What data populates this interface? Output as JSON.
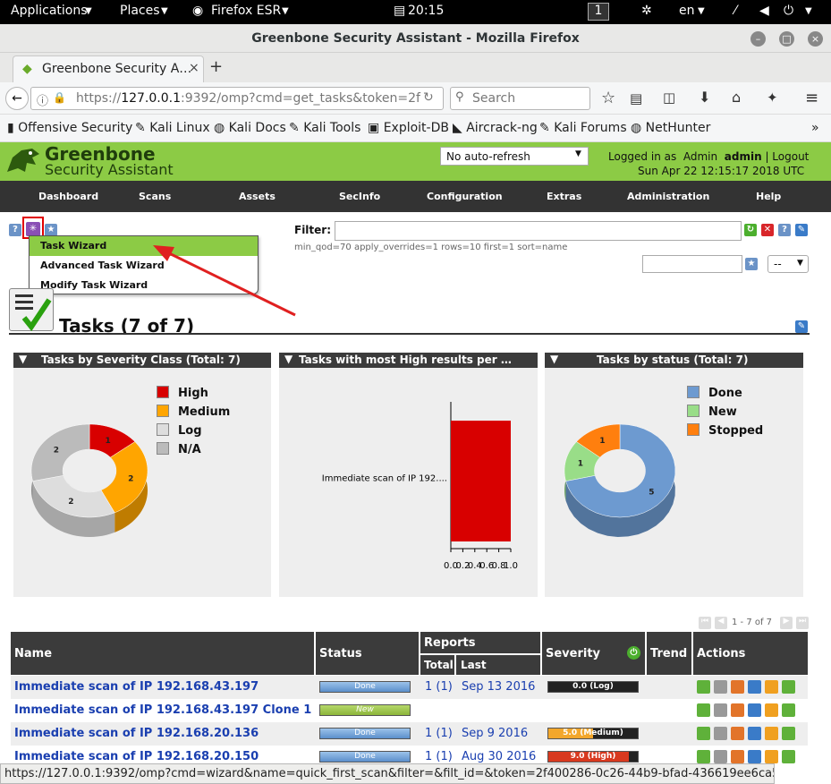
{
  "gnome": {
    "applications": "Applications",
    "places": "Places",
    "browser": "Firefox ESR",
    "time": "20:15",
    "workspace": "1",
    "lang": "en"
  },
  "window": {
    "title": "Greenbone Security Assistant - Mozilla Firefox"
  },
  "tab": {
    "label": "Greenbone Security A…",
    "new_tab": "+"
  },
  "nav": {
    "url_prefix": "https://",
    "url_host": "127.0.0.1",
    "url_rest": ":9392/omp?cmd=get_tasks&token=2f",
    "search_placeholder": "Search"
  },
  "bookmarks": [
    "Offensive Security",
    "Kali Linux",
    "Kali Docs",
    "Kali Tools",
    "Exploit-DB",
    "Aircrack-ng",
    "Kali Forums",
    "NetHunter"
  ],
  "gsa": {
    "logo_line1": "Greenbone",
    "logo_line2": "Security Assistant",
    "refresh": "No auto-refresh",
    "logged_in_prefix": "Logged in as",
    "role": "Admin",
    "user": "admin",
    "logout": "Logout",
    "datetime": "Sun Apr 22 12:15:17 2018 UTC",
    "menu": [
      "Dashboard",
      "Scans",
      "Assets",
      "SecInfo",
      "Configuration",
      "Extras",
      "Administration",
      "Help"
    ],
    "filter_label": "Filter:",
    "filter_params": "min_qod=70 apply_overrides=1 rows=10 first=1 sort=name",
    "filter_select": "--",
    "wizard_menu": [
      "Task Wizard",
      "Advanced Task Wizard",
      "Modify Task Wizard"
    ],
    "page_title": "Tasks (7 of 7)",
    "pagination": "1 - 7 of 7"
  },
  "panels": {
    "severity": {
      "title": "Tasks by Severity Class (Total: 7)"
    },
    "high": {
      "title": "Tasks with most High results per …"
    },
    "status": {
      "title": "Tasks by status (Total: 7)"
    }
  },
  "chart_data": [
    {
      "type": "pie",
      "title": "Tasks by Severity Class (Total: 7)",
      "categories": [
        "High",
        "Medium",
        "Log",
        "N/A"
      ],
      "values": [
        1,
        2,
        2,
        2
      ],
      "colors": [
        "#d80000",
        "#ffa500",
        "#dddddd",
        "#bbbbbb"
      ],
      "legend": "top-right"
    },
    {
      "type": "bar",
      "title": "Tasks with most High results per …",
      "categories": [
        "Immediate scan of IP 192...."
      ],
      "values": [
        1.0
      ],
      "ticks": [
        "0.0",
        "0.2",
        "0.4",
        "0.6",
        "0.8",
        "1.0"
      ],
      "ylim": [
        0,
        1
      ],
      "colors": [
        "#d80000"
      ]
    },
    {
      "type": "pie",
      "title": "Tasks by status (Total: 7)",
      "categories": [
        "Done",
        "New",
        "Stopped"
      ],
      "values": [
        5,
        1,
        1
      ],
      "colors": [
        "#6d9ad0",
        "#99dd88",
        "#ff7f0e"
      ],
      "legend": "top-right"
    }
  ],
  "table": {
    "headers": {
      "name": "Name",
      "status": "Status",
      "reports": "Reports",
      "total": "Total",
      "last": "Last",
      "severity": "Severity",
      "trend": "Trend",
      "actions": "Actions"
    },
    "rows": [
      {
        "name": "Immediate scan of IP 192.168.43.197",
        "status": "Done",
        "total": "1 (1)",
        "last": "Sep 13 2016",
        "severity": "0.0 (Log)",
        "sev_fill": 0
      },
      {
        "name": "Immediate scan of IP 192.168.43.197 Clone 1",
        "status": "New",
        "total": "",
        "last": "",
        "severity": "",
        "sev_fill": null
      },
      {
        "name": "Immediate scan of IP 192.168.20.136",
        "status": "Done",
        "total": "1 (1)",
        "last": "Sep 9 2016",
        "severity": "5.0 (Medium)",
        "sev_fill": 0.5
      },
      {
        "name": "Immediate scan of IP 192.168.20.150",
        "status": "Done",
        "total": "1 (1)",
        "last": "Aug 30 2016",
        "severity": "9.0 (High)",
        "sev_fill": 0.9
      }
    ]
  },
  "statusbar": "https://127.0.0.1:9392/omp?cmd=wizard&name=quick_first_scan&filter=&filt_id=&token=2f400286-0c26-44b9-bfad-436619ee6ca5"
}
